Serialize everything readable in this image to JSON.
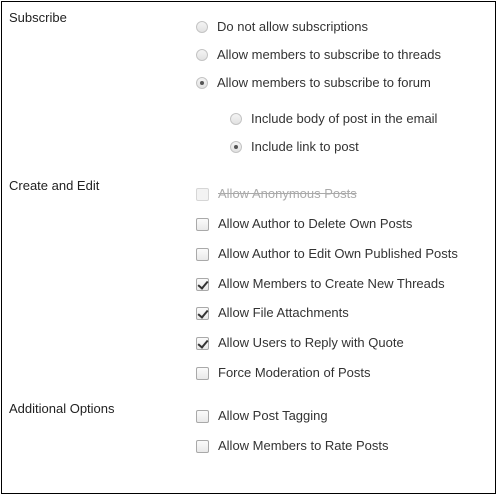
{
  "sections": {
    "subscribe": {
      "label": "Subscribe",
      "options": [
        {
          "label": "Do not allow subscriptions",
          "checked": false
        },
        {
          "label": "Allow members to subscribe to threads",
          "checked": false
        },
        {
          "label": "Allow members to subscribe to forum",
          "checked": true
        }
      ],
      "sub_options": [
        {
          "label": "Include body of post in the email",
          "checked": false
        },
        {
          "label": "Include link to post",
          "checked": true
        }
      ]
    },
    "create_edit": {
      "label": "Create and Edit",
      "options": [
        {
          "label": "Allow Anonymous Posts",
          "checked": false,
          "disabled": true
        },
        {
          "label": "Allow Author to Delete Own Posts",
          "checked": false
        },
        {
          "label": "Allow Author to Edit Own Published Posts",
          "checked": false
        },
        {
          "label": "Allow Members to Create New Threads",
          "checked": true
        },
        {
          "label": "Allow File Attachments",
          "checked": true
        },
        {
          "label": "Allow Users to Reply with Quote",
          "checked": true
        },
        {
          "label": "Force Moderation of Posts",
          "checked": false
        }
      ]
    },
    "additional": {
      "label": "Additional Options",
      "options": [
        {
          "label": "Allow Post Tagging",
          "checked": false
        },
        {
          "label": "Allow Members to Rate Posts",
          "checked": false
        }
      ]
    }
  }
}
